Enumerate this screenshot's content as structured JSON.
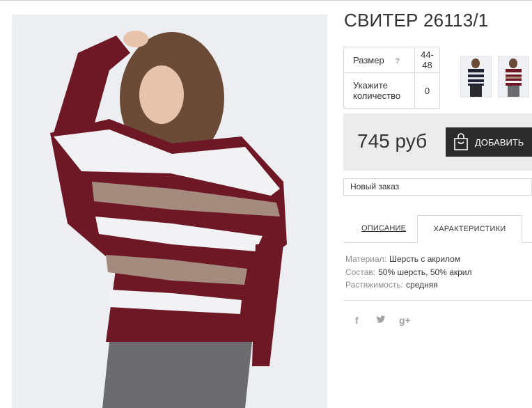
{
  "product": {
    "title": "СВИТЕР 26113/1",
    "main_image_alt": "photo"
  },
  "specs": {
    "size_label": "Размер",
    "help_symbol": "?",
    "size_value": "44-48",
    "qty_label": "Укажите количество",
    "qty_value": "0"
  },
  "price": {
    "amount": "745 руб",
    "add_button_label": "ДОБАВИТЬ"
  },
  "order": {
    "selected": "Новый заказ"
  },
  "tabs": {
    "description": "ОПИСАНИЕ",
    "characteristics": "ХАРАКТЕРИСТИКИ"
  },
  "properties": [
    {
      "key": "Материал:",
      "value": "Шерсть с акрилом"
    },
    {
      "key": "Состав:",
      "value": "50% шерсть, 50% акрил"
    },
    {
      "key": "Растяжимость:",
      "value": "средняя"
    }
  ],
  "social": {
    "facebook": "f",
    "twitter": "twitter-icon",
    "googleplus": "g+"
  },
  "colors": {
    "sweater_burgundy": "#6e1826",
    "stripe_beige": "#a48b7e",
    "stripe_white": "#f2f2f4",
    "button_dark": "#2b2b2b",
    "price_bg": "#ececec"
  }
}
